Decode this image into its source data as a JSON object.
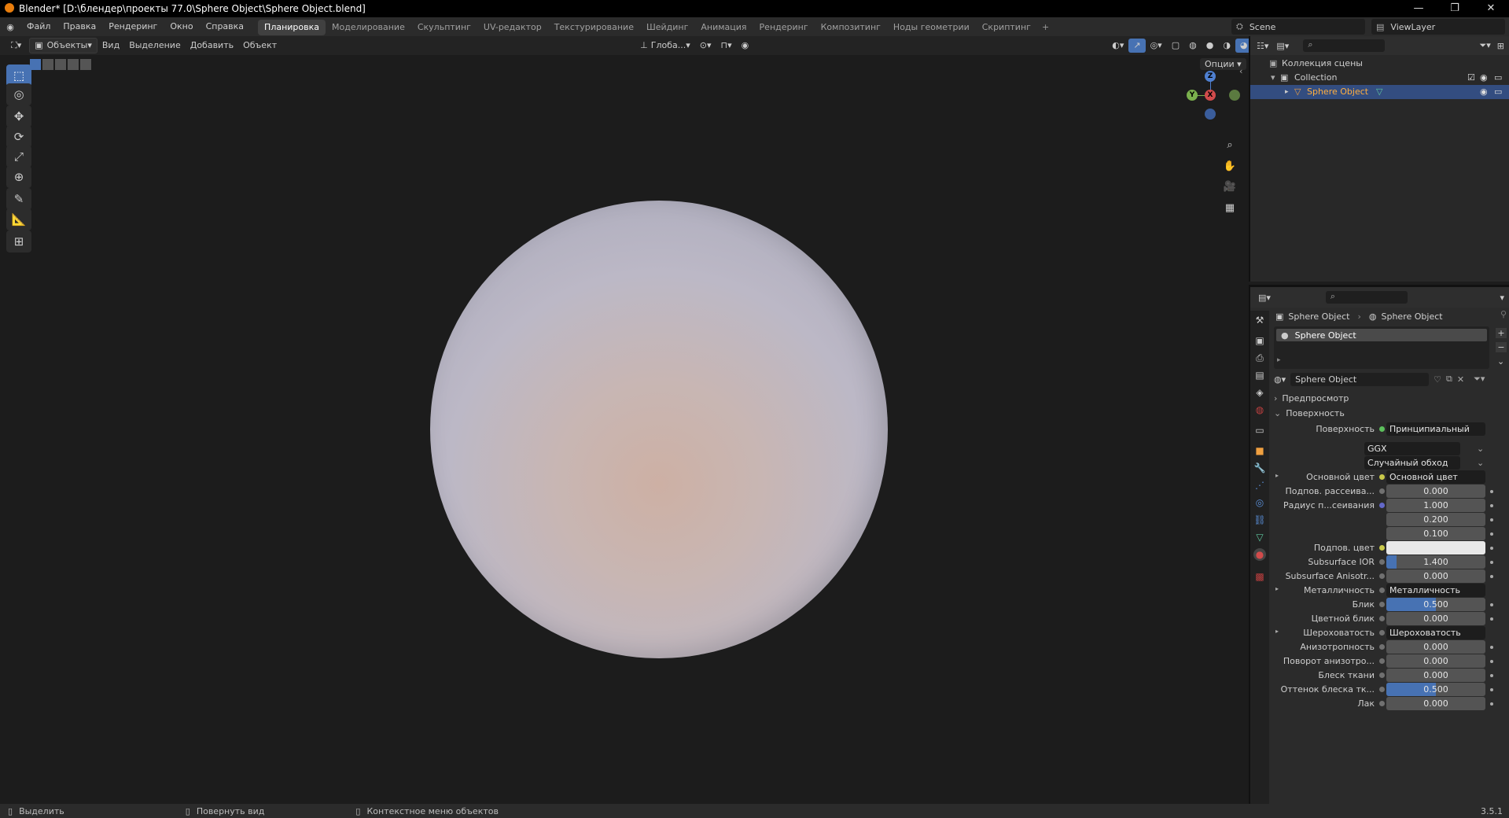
{
  "window": {
    "title": "Blender* [D:\\блендер\\проекты 77.0\\Sphere Object\\Sphere Object.blend]",
    "min_icon": "minimize-icon",
    "max_icon": "maximize-icon",
    "close_icon": "close-icon"
  },
  "menu": [
    "Файл",
    "Правка",
    "Рендеринг",
    "Окно",
    "Справка"
  ],
  "workspaces": [
    "Планировка",
    "Моделирование",
    "Скульптинг",
    "UV-редактор",
    "Текстурирование",
    "Шейдинг",
    "Анимация",
    "Рендеринг",
    "Композитинг",
    "Ноды геометрии",
    "Скриптинг"
  ],
  "active_workspace": "Планировка",
  "add_workspace": "+",
  "scene": {
    "name": "Scene",
    "view_layer": "ViewLayer"
  },
  "viewport_header": {
    "mode": "Объекты",
    "menus": [
      "Вид",
      "Выделение",
      "Добавить",
      "Объект"
    ],
    "orientation": "Глоба...",
    "options": "Опции"
  },
  "tools": [
    "select-box-icon",
    "cursor-icon",
    "move-icon",
    "rotate-icon",
    "scale-icon",
    "transform-icon",
    "annotate-icon",
    "measure-icon",
    "add-cube-icon"
  ],
  "gizmo": {
    "x": "X",
    "y": "Y",
    "z": "Z"
  },
  "outliner": {
    "root": "Коллекция сцены",
    "collection": "Collection",
    "object": "Sphere Object"
  },
  "properties": {
    "breadcrumb": [
      "Sphere Object",
      "Sphere Object"
    ],
    "slot": "Sphere Object",
    "material_name": "Sphere Object",
    "sections": {
      "preview": "Предпросмотр",
      "surface": "Поверхность"
    },
    "surface_shader": "Принципиальный BSDF",
    "distribution": "GGX",
    "subsurface_method": "Случайный обход",
    "rows": [
      {
        "label": "Основной цвет",
        "type": "link",
        "value": "Основной цвет",
        "dot": "yel",
        "expand": true
      },
      {
        "label": "Подпов. рассеива...",
        "type": "num",
        "value": "0.000",
        "dot": "gray"
      },
      {
        "label": "Радиус п...сеивания",
        "type": "num",
        "value": "1.000",
        "dot": "blu"
      },
      {
        "label": "",
        "type": "num",
        "value": "0.200",
        "dot": "none"
      },
      {
        "label": "",
        "type": "num",
        "value": "0.100",
        "dot": "none"
      },
      {
        "label": "Подпов. цвет",
        "type": "color",
        "value": "",
        "dot": "yel"
      },
      {
        "label": "Subsurface IOR",
        "type": "num",
        "value": "1.400",
        "dot": "gray",
        "fill": 0.1
      },
      {
        "label": "Subsurface Anisotr...",
        "type": "num",
        "value": "0.000",
        "dot": "gray"
      },
      {
        "label": "Металличность",
        "type": "link",
        "value": "Металличность",
        "dot": "gray",
        "expand": true
      },
      {
        "label": "Блик",
        "type": "num",
        "value": "0.500",
        "dot": "gray",
        "fill": 0.5
      },
      {
        "label": "Цветной блик",
        "type": "num",
        "value": "0.000",
        "dot": "gray"
      },
      {
        "label": "Шероховатость",
        "type": "link",
        "value": "Шероховатость",
        "dot": "gray",
        "expand": true
      },
      {
        "label": "Анизотропность",
        "type": "num",
        "value": "0.000",
        "dot": "gray"
      },
      {
        "label": "Поворот анизотро...",
        "type": "num",
        "value": "0.000",
        "dot": "gray"
      },
      {
        "label": "Блеск ткани",
        "type": "num",
        "value": "0.000",
        "dot": "gray"
      },
      {
        "label": "Оттенок блеска тк...",
        "type": "num",
        "value": "0.500",
        "dot": "gray",
        "fill": 0.5
      },
      {
        "label": "Лак",
        "type": "num",
        "value": "0.000",
        "dot": "gray"
      }
    ]
  },
  "status": {
    "left": "Выделить",
    "middle": "Повернуть вид",
    "right": "Контекстное меню объектов",
    "version": "3.5.1"
  }
}
